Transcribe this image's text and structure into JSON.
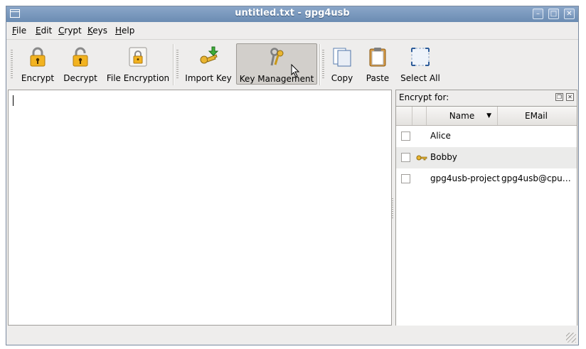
{
  "window": {
    "title": "untitled.txt - gpg4usb"
  },
  "menu": [
    "File",
    "Edit",
    "Crypt",
    "Keys",
    "Help"
  ],
  "toolbar": {
    "encrypt": "Encrypt",
    "decrypt": "Decrypt",
    "file_encryption": "File Encryption",
    "import_key": "Import Key",
    "key_management": "Key Management",
    "copy": "Copy",
    "paste": "Paste",
    "select_all": "Select All"
  },
  "dock": {
    "title": "Encrypt for:",
    "columns": {
      "name": "Name",
      "email": "EMail"
    },
    "keys": [
      {
        "name": "Alice",
        "email": "",
        "checked": false,
        "private": false
      },
      {
        "name": "Bobby",
        "email": "",
        "checked": false,
        "private": true
      },
      {
        "name": "gpg4usb-project",
        "email": "gpg4usb@cpun…",
        "checked": false,
        "private": false
      }
    ]
  },
  "colors": {
    "titlebar": "#7a97bd",
    "active_button": "#d2cfcb",
    "alt_row": "#ebebea"
  },
  "icons": [
    "lock-icon",
    "unlock-icon",
    "file-lock-icon",
    "key-import-icon",
    "keys-icon",
    "copy-icon",
    "paste-icon",
    "select-all-icon",
    "key-icon"
  ]
}
